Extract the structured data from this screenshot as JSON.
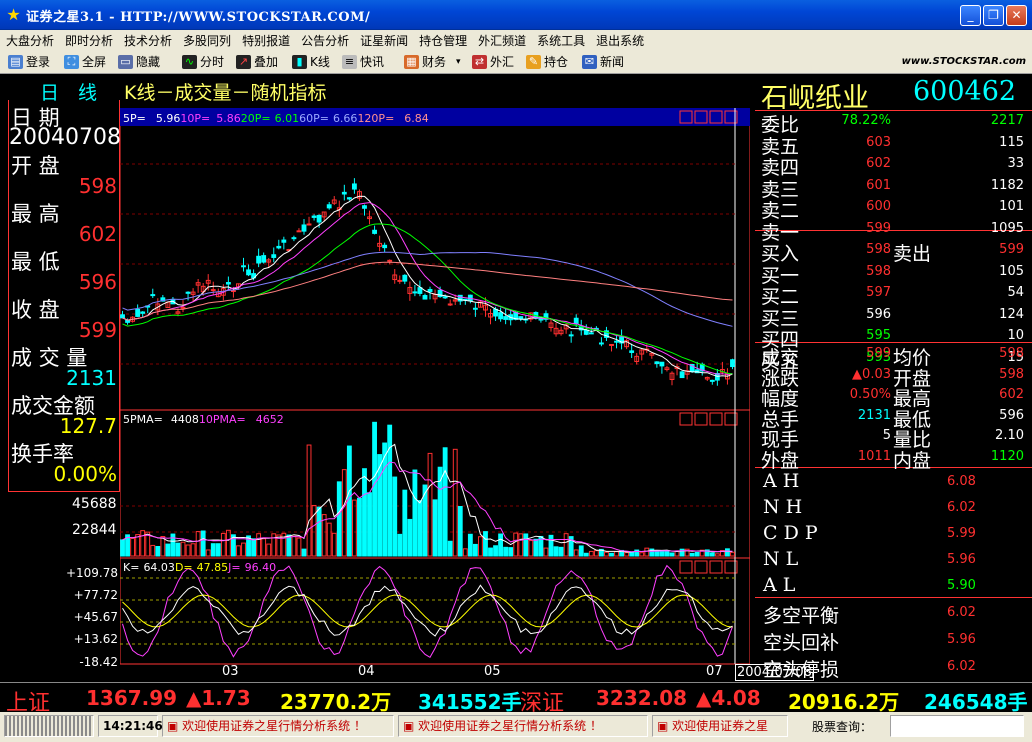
{
  "window": {
    "title": "证券之星3.1 - HTTP://WWW.STOCKSTAR.COM/"
  },
  "menu": [
    "大盘分析",
    "即时分析",
    "技术分析",
    "多股同列",
    "特别报道",
    "公告分析",
    "证星新闻",
    "持仓管理",
    "外汇频道",
    "系统工具",
    "退出系统"
  ],
  "toolbar": {
    "items": [
      "登录",
      "全屏",
      "隐藏",
      "分时",
      "叠加",
      "K线",
      "快讯",
      "财务",
      "外汇",
      "持仓",
      "新闻"
    ],
    "logo": "www.STOCKSTAR.com"
  },
  "chart_header": {
    "tab_daily": "日",
    "tab_line": "线",
    "title": "K线－成交量－随机指标"
  },
  "left_info": {
    "date_label": "日   期",
    "date": "20040708",
    "open_label": "开   盘",
    "open": "598",
    "high_label": "最   高",
    "high": "602",
    "low_label": "最   低",
    "low": "596",
    "close_label": "收   盘",
    "close": "599",
    "vol_label": "成 交 量",
    "vol": "2131",
    "amount_label": "成交金额",
    "amount": "127.7",
    "turnover_label": "换手率",
    "turnover": "0.00%"
  },
  "ma_legend": {
    "p5_label": "5P=",
    "p5": "5.96",
    "p10_label": "10P=",
    "p10": "5.86",
    "p20_label": "20P=",
    "p20": "6.01",
    "p60_label": "60P=",
    "p60": "6.66",
    "p120_label": "120P=",
    "p120": "6.84"
  },
  "vol_legend": {
    "p5_label": "5PMA=",
    "p5": "4408",
    "p10_label": "10PMA=",
    "p10": "4652"
  },
  "vol_axis": [
    "45688",
    "22844"
  ],
  "kdj_legend": {
    "k_label": "K=",
    "k": "64.03",
    "d_label": "D=",
    "d": "47.85",
    "j_label": "J=",
    "j": "96.40"
  },
  "kdj_axis": [
    "+109.78",
    "+77.72",
    "+45.67",
    "+13.62",
    "-18.42"
  ],
  "x_axis": [
    "03",
    "04",
    "05",
    "07"
  ],
  "cursor_date": "2004/07/08",
  "stock": {
    "name": "石岘纸业",
    "code": "600462"
  },
  "quote": {
    "weibi_label": "委比",
    "weibi": "78.22%",
    "weicha": "2217",
    "sell5_label": "卖五",
    "sell5": "603",
    "sell5v": "115",
    "sell4_label": "卖四",
    "sell4": "602",
    "sell4v": "33",
    "sell3_label": "卖三",
    "sell3": "601",
    "sell3v": "1182",
    "sell2_label": "卖二",
    "sell2": "600",
    "sell2v": "101",
    "sell1_label": "卖一",
    "sell1": "599",
    "sell1v": "1095",
    "buyin_label": "买入",
    "buyin": "598",
    "sellout_label": "卖出",
    "sellout": "599",
    "buy1_label": "买一",
    "buy1": "598",
    "buy1v": "105",
    "buy2_label": "买二",
    "buy2": "597",
    "buy2v": "54",
    "buy3_label": "买三",
    "buy3": "596",
    "buy3v": "124",
    "buy4_label": "买四",
    "buy4": "595",
    "buy4v": "10",
    "buy5_label": "买五",
    "buy5": "593",
    "buy5v": "15",
    "deal_label": "成交",
    "deal": "599",
    "avg_label": "均价",
    "avg": "598",
    "chg_label": "涨跌",
    "chg": "▲0.03",
    "open_label": "开盘",
    "open": "598",
    "amp_label": "幅度",
    "amp": "0.50%",
    "high_label": "最高",
    "high": "602",
    "totalhand_label": "总手",
    "totalhand": "2131",
    "low_label": "最低",
    "low": "596",
    "curhand_label": "现手",
    "curhand": "5",
    "volratio_label": "量比",
    "volratio": "2.10",
    "outer_label": "外盘",
    "outer": "1011",
    "inner_label": "内盘",
    "inner": "1120"
  },
  "indicators": [
    {
      "label": "A H",
      "value": "6.08"
    },
    {
      "label": "N H",
      "value": "6.02"
    },
    {
      "label": "C D P",
      "value": "5.99"
    },
    {
      "label": "N L",
      "value": "5.96"
    },
    {
      "label": "A L",
      "value": "5.90"
    }
  ],
  "signals": [
    {
      "label": "多空平衡",
      "value": "6.02"
    },
    {
      "label": "空头回补",
      "value": "5.96"
    },
    {
      "label": "空头停损",
      "value": "6.02"
    }
  ],
  "ticker": {
    "sh_label": "上证",
    "sh_index": "1367.99",
    "sh_chg": "▲1.73",
    "sh_amt": "23770.2万",
    "sh_vol": "341552手",
    "sz_label": "深证",
    "sz_index": "3232.08",
    "sz_chg": "▲4.08",
    "sz_amt": "20916.2万",
    "sz_vol": "246548手"
  },
  "status": {
    "time": "14:21:46",
    "msg1": "欢迎使用证券之星行情分析系统 ！",
    "msg2": "欢迎使用证券之星行情分析系统 ！",
    "msg3": "欢迎使用证券之星",
    "query_label": "股票查询："
  },
  "colors": {
    "up": "#ff3030",
    "down": "#00ffff",
    "ma5": "#ffffff",
    "ma10": "#ff40ff",
    "ma20": "#00ff00",
    "ma60": "#8080ff",
    "ma120": "#ff8080",
    "grid": "#800000"
  }
}
